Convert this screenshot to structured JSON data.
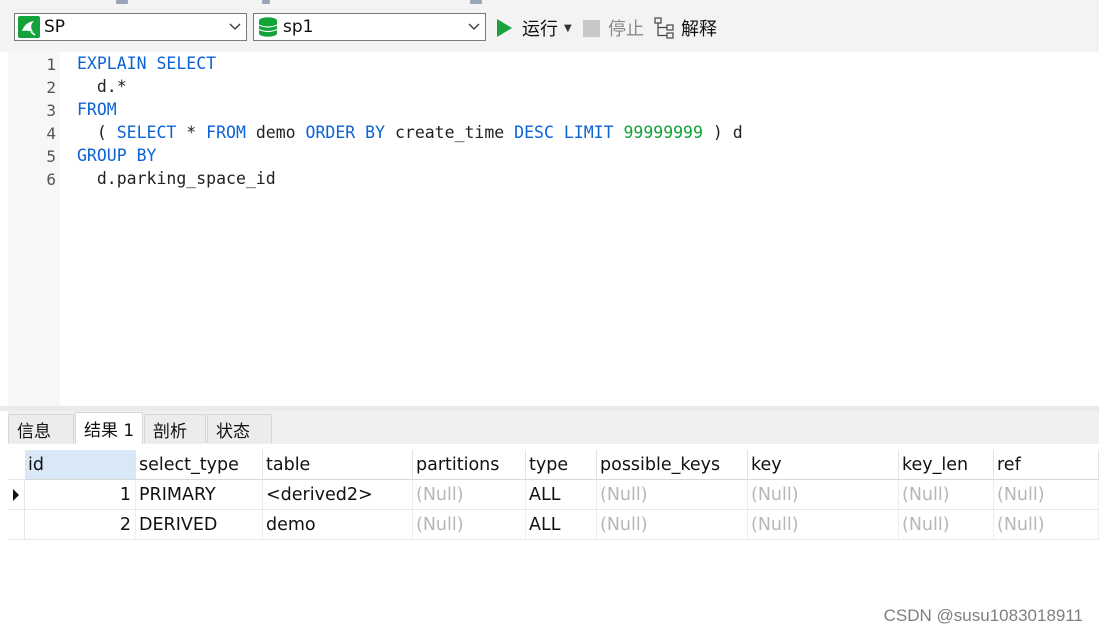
{
  "toolbar": {
    "connection": "SP",
    "database": "sp1",
    "run_label": "运行",
    "stop_label": "停止",
    "explain_label": "解释",
    "run_color": "#19a43b"
  },
  "editor": {
    "line_numbers": [
      "1",
      "2",
      "3",
      "4",
      "5",
      "6"
    ],
    "lines": {
      "l1": {
        "kw1": "EXPLAIN SELECT"
      },
      "l2": {
        "t1": "  d.*"
      },
      "l3": {
        "kw1": "FROM"
      },
      "l4": {
        "t1": "  ( ",
        "kw1": "SELECT",
        "t2": " * ",
        "kw2": "FROM",
        "t3": " demo ",
        "kw3": "ORDER BY",
        "t4": " create_time ",
        "kw4": "DESC",
        "t5": " ",
        "kw5": "LIMIT",
        "t6": " ",
        "num1": "99999999",
        "t7": " ) d"
      },
      "l5": {
        "kw1": "GROUP BY"
      },
      "l6": {
        "t1": "  d.parking_space_id"
      }
    },
    "keyword_color": "#0b63d6",
    "number_color": "#13a33b"
  },
  "tabs": [
    "信息",
    "结果 1",
    "剖析",
    "状态"
  ],
  "active_tab": "结果 1",
  "grid": {
    "columns": [
      "id",
      "select_type",
      "table",
      "partitions",
      "type",
      "possible_keys",
      "key",
      "key_len",
      "ref"
    ],
    "rows": [
      [
        "1",
        "PRIMARY",
        "<derived2>",
        "(Null)",
        "ALL",
        "(Null)",
        "(Null)",
        "(Null)",
        "(Null)"
      ],
      [
        "2",
        "DERIVED",
        "demo",
        "(Null)",
        "ALL",
        "(Null)",
        "(Null)",
        "(Null)",
        "(Null)"
      ]
    ]
  },
  "watermark": "CSDN @susu1083018911"
}
